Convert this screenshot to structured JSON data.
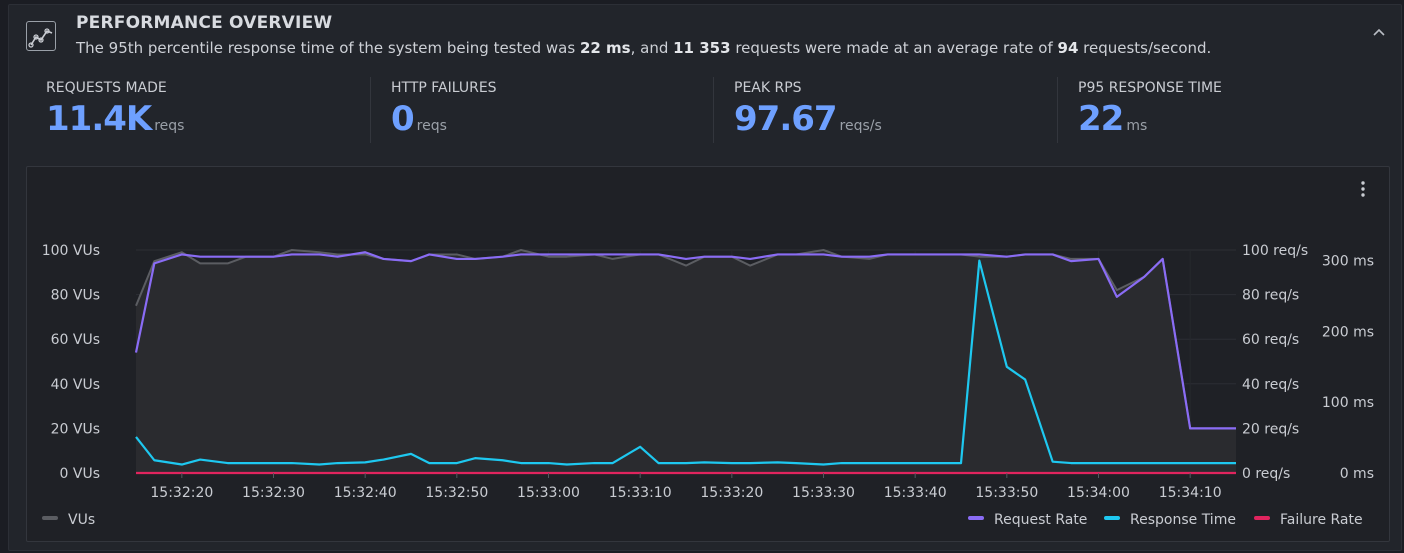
{
  "header": {
    "title": "PERFORMANCE OVERVIEW",
    "desc": {
      "p1": "The 95th percentile response time of the system being tested was ",
      "p95": "22 ms",
      "p2": ", and ",
      "requests": "11 353",
      "p3": " requests were made at an average rate of ",
      "rate": "94",
      "p4": " requests/second."
    },
    "icon": "chart-line-icon",
    "collapse_icon": "chevron-up-icon"
  },
  "stats": [
    {
      "label": "REQUESTS MADE",
      "value": "11.4K",
      "unit": "reqs"
    },
    {
      "label": "HTTP FAILURES",
      "value": "0",
      "unit": "reqs"
    },
    {
      "label": "PEAK RPS",
      "value": "97.67",
      "unit": "reqs/s"
    },
    {
      "label": "P95 RESPONSE TIME",
      "value": "22",
      "unit": "ms"
    }
  ],
  "colors": {
    "accent": "#6ea0ff",
    "vus": "#5b5d62",
    "request_rate": "#8a6cf5",
    "response_time": "#1ec8f0",
    "failure_rate": "#e0245e"
  },
  "chart_data": {
    "type": "line",
    "x": [
      "15:32:15",
      "15:32:17",
      "15:32:20",
      "15:32:22",
      "15:32:25",
      "15:32:27",
      "15:32:30",
      "15:32:32",
      "15:32:35",
      "15:32:37",
      "15:32:40",
      "15:32:42",
      "15:32:45",
      "15:32:47",
      "15:32:50",
      "15:32:52",
      "15:32:55",
      "15:32:57",
      "15:33:00",
      "15:33:02",
      "15:33:05",
      "15:33:07",
      "15:33:10",
      "15:33:12",
      "15:33:15",
      "15:33:17",
      "15:33:20",
      "15:33:22",
      "15:33:25",
      "15:33:27",
      "15:33:30",
      "15:33:32",
      "15:33:35",
      "15:33:37",
      "15:33:40",
      "15:33:42",
      "15:33:45",
      "15:33:47",
      "15:33:50",
      "15:33:52",
      "15:33:55",
      "15:33:57",
      "15:34:00",
      "15:34:02",
      "15:34:05",
      "15:34:07",
      "15:34:10",
      "15:34:12",
      "15:34:15"
    ],
    "x_ticks": [
      "15:32:20",
      "15:32:30",
      "15:32:40",
      "15:32:50",
      "15:33:00",
      "15:33:10",
      "15:33:20",
      "15:33:30",
      "15:33:40",
      "15:33:50",
      "15:34:00",
      "15:34:10"
    ],
    "y_left": {
      "ticks": [
        "0 VUs",
        "20 VUs",
        "40 VUs",
        "60 VUs",
        "80 VUs",
        "100 VUs"
      ],
      "range": [
        0,
        100
      ]
    },
    "y_req": {
      "ticks": [
        "0 req/s",
        "20 req/s",
        "40 req/s",
        "60 req/s",
        "80 req/s",
        "100 req/s"
      ],
      "range": [
        0,
        100
      ]
    },
    "y_ms": {
      "ticks": [
        "0 ms",
        "100 ms",
        "200 ms",
        "300 ms"
      ],
      "range": [
        0,
        300
      ]
    },
    "series": [
      {
        "name": "VUs",
        "axis": "vus",
        "values": [
          75,
          95,
          99,
          94,
          94,
          97,
          97,
          100,
          99,
          98,
          98,
          96,
          95,
          98,
          98,
          96,
          97,
          100,
          97,
          97,
          98,
          96,
          98,
          98,
          93,
          97,
          97,
          93,
          98,
          98,
          100,
          97,
          96,
          98,
          98,
          98,
          98,
          97,
          97,
          98,
          98,
          96,
          96,
          82,
          88,
          96,
          20,
          20,
          20
        ]
      },
      {
        "name": "Request Rate",
        "axis": "req",
        "values": [
          54,
          94,
          98,
          97,
          97,
          97,
          97,
          98,
          98,
          97,
          99,
          96,
          95,
          98,
          96,
          96,
          97,
          98,
          98,
          98,
          98,
          98,
          98,
          98,
          96,
          97,
          97,
          96,
          98,
          98,
          98,
          97,
          97,
          98,
          98,
          98,
          98,
          98,
          97,
          98,
          98,
          95,
          96,
          79,
          88,
          96,
          20,
          20,
          20
        ]
      },
      {
        "name": "Response Time",
        "axis": "ms",
        "values": [
          51,
          18,
          12,
          19,
          14,
          14,
          14,
          14,
          12,
          14,
          15,
          19,
          27,
          14,
          14,
          21,
          18,
          14,
          14,
          12,
          14,
          14,
          37,
          14,
          14,
          15,
          14,
          14,
          15,
          14,
          12,
          14,
          14,
          14,
          14,
          14,
          14,
          300,
          150,
          132,
          16,
          14,
          14,
          14,
          14,
          14,
          14,
          14,
          14
        ]
      },
      {
        "name": "Failure Rate",
        "axis": "req",
        "values": [
          0,
          0,
          0,
          0,
          0,
          0,
          0,
          0,
          0,
          0,
          0,
          0,
          0,
          0,
          0,
          0,
          0,
          0,
          0,
          0,
          0,
          0,
          0,
          0,
          0,
          0,
          0,
          0,
          0,
          0,
          0,
          0,
          0,
          0,
          0,
          0,
          0,
          0,
          0,
          0,
          0,
          0,
          0,
          0,
          0,
          0,
          0,
          0,
          0
        ]
      }
    ],
    "legend": {
      "left": [
        "VUs"
      ],
      "right": [
        "Request Rate",
        "Response Time",
        "Failure Rate"
      ],
      "placement": "bottom"
    },
    "grid": true
  }
}
